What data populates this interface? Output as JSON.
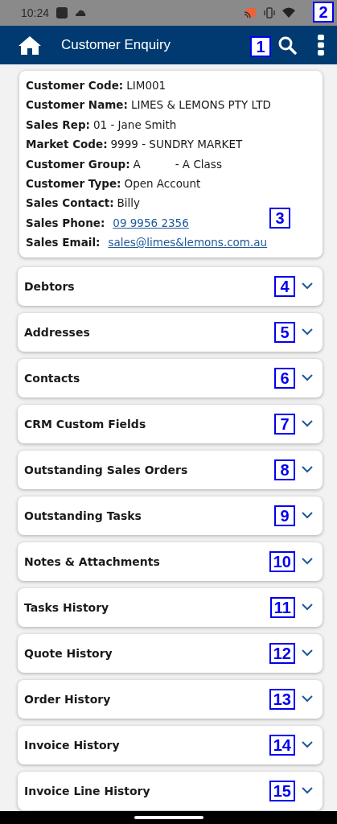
{
  "status_bar": {
    "time": "10:24",
    "marker": "2"
  },
  "app_bar": {
    "title": "Customer Enquiry",
    "marker": "1"
  },
  "customer": {
    "marker": "3",
    "fields": [
      {
        "label": "Customer Code:",
        "value": "LIM001",
        "kind": "text"
      },
      {
        "label": "Customer Name:",
        "value": "LIMES & LEMONS PTY LTD",
        "kind": "text"
      },
      {
        "label": "Sales Rep:",
        "value": "01 - Jane Smith",
        "kind": "text"
      },
      {
        "label": "Market Code:",
        "value": "9999 - SUNDRY MARKET",
        "kind": "text"
      },
      {
        "label": "Customer Group:",
        "value": "A          - A Class",
        "kind": "text"
      },
      {
        "label": "Customer Type:",
        "value": "Open Account",
        "kind": "text"
      },
      {
        "label": "Sales Contact:",
        "value": "Billy",
        "kind": "text"
      },
      {
        "label": "Sales Phone:",
        "value": "09 9956 2356",
        "kind": "link"
      },
      {
        "label": "Sales Email:",
        "value": "sales@limes&lemons.com.au",
        "kind": "link"
      }
    ]
  },
  "sections": [
    {
      "title": "Debtors",
      "marker": "4",
      "expanded": false
    },
    {
      "title": "Addresses",
      "marker": "5",
      "expanded": false
    },
    {
      "title": "Contacts",
      "marker": "6",
      "expanded": false
    },
    {
      "title": "CRM Custom Fields",
      "marker": "7",
      "expanded": false
    },
    {
      "title": "Outstanding Sales Orders",
      "marker": "8",
      "expanded": false
    },
    {
      "title": "Outstanding Tasks",
      "marker": "9",
      "expanded": false
    },
    {
      "title": "Notes & Attachments",
      "marker": "10",
      "expanded": false
    },
    {
      "title": "Tasks History",
      "marker": "11",
      "expanded": false
    },
    {
      "title": "Quote History",
      "marker": "12",
      "expanded": false
    },
    {
      "title": "Order History",
      "marker": "13",
      "expanded": false
    },
    {
      "title": "Invoice History",
      "marker": "14",
      "expanded": false
    },
    {
      "title": "Invoice Line History",
      "marker": "15",
      "expanded": false
    }
  ]
}
